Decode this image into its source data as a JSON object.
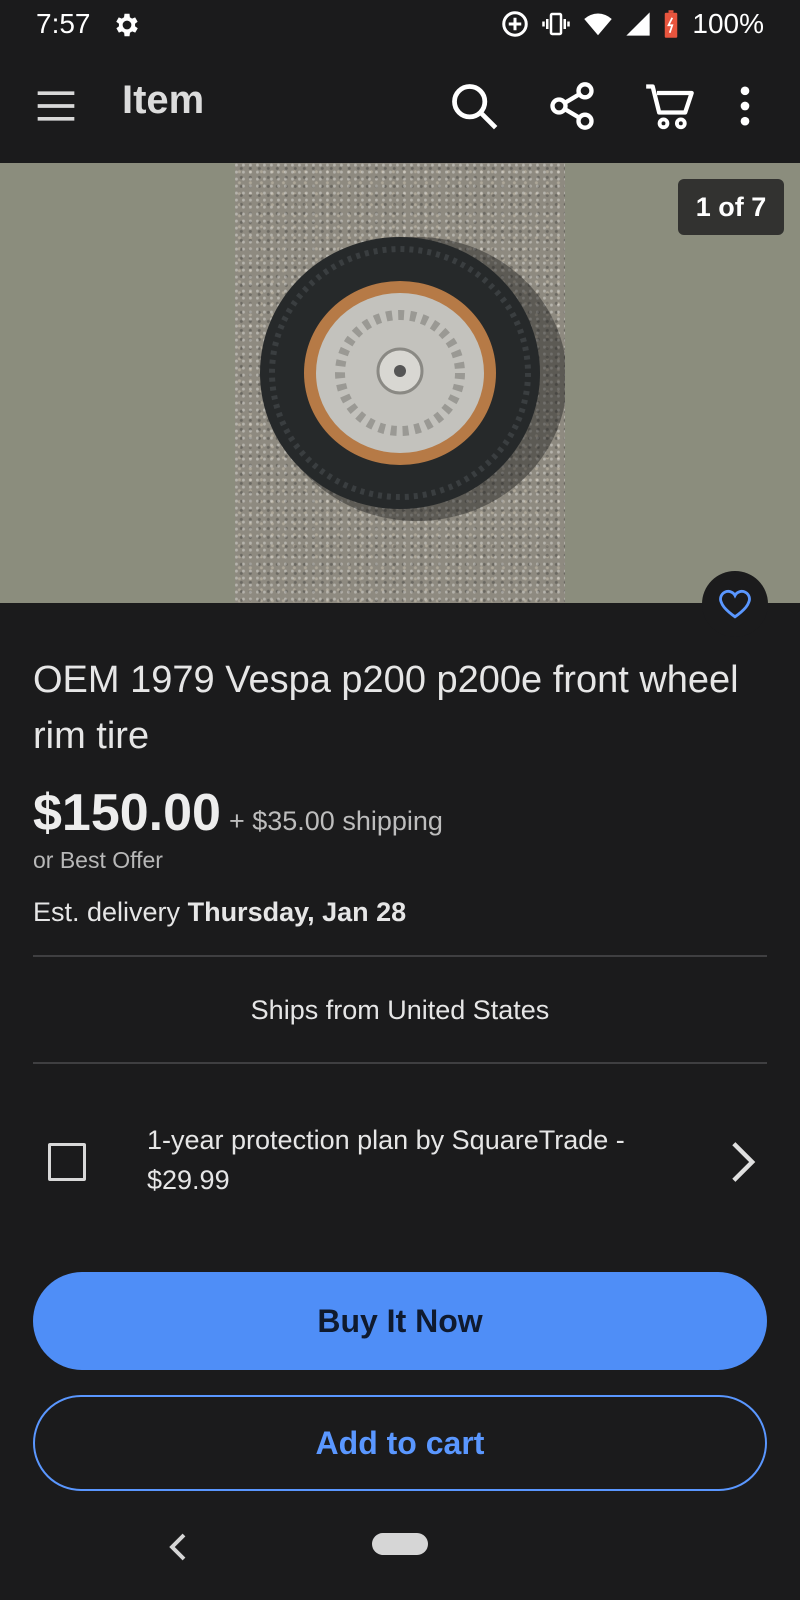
{
  "status_bar": {
    "time": "7:57",
    "battery": "100%"
  },
  "app_bar": {
    "title": "Item"
  },
  "gallery": {
    "counter": "1 of 7"
  },
  "listing": {
    "title": "OEM 1979 Vespa p200 p200e  front wheel rim tire",
    "price": "$150.00",
    "shipping": "+ $35.00 shipping",
    "best_offer": "or Best Offer",
    "delivery_prefix": "Est. delivery",
    "delivery_date": "Thursday, Jan 28",
    "ships_from": "Ships from United States",
    "protection_plan": "1-year protection plan by SquareTrade - $29.99"
  },
  "actions": {
    "buy_now": "Buy It Now",
    "add_to_cart": "Add to cart"
  },
  "colors": {
    "background": "#1b1b1c",
    "accent": "#4f8ef7",
    "outline_button": "#5a97ff"
  },
  "icons": [
    "settings-icon",
    "data-saver-icon",
    "vibrate-icon",
    "wifi-icon",
    "signal-icon",
    "battery-icon",
    "menu-icon",
    "search-icon",
    "share-icon",
    "cart-icon",
    "more-icon",
    "heart-icon",
    "chevron-right-icon",
    "back-icon"
  ]
}
